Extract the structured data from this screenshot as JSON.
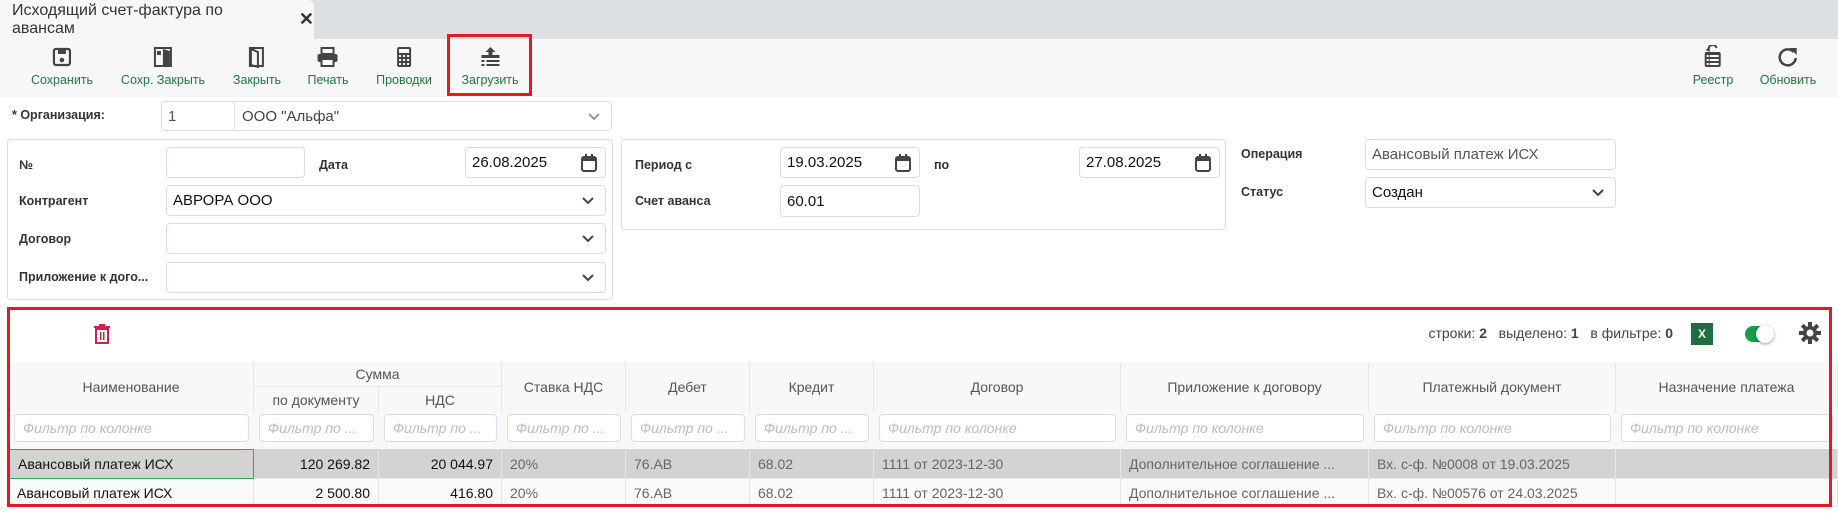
{
  "tab": {
    "title": "Исходящий счет-фактура по авансам"
  },
  "toolbar": {
    "save": "Сохранить",
    "save_close": "Сохр. Закрыть",
    "close": "Закрыть",
    "print": "Печать",
    "postings": "Проводки",
    "upload": "Загрузить",
    "registry": "Реестр",
    "refresh": "Обновить"
  },
  "form": {
    "org_label": "* Организация:",
    "org_code": "1",
    "org_name": "ООО \"Альфа\"",
    "number_label": "№",
    "number_value": "",
    "date_label": "Дата",
    "date_value": "26.08.2025",
    "counterparty_label": "Контрагент",
    "counterparty_value": "АВРОРА ООО",
    "contract_label": "Договор",
    "contract_value": "",
    "annex_label": "Приложение к дого...",
    "annex_value": "",
    "period_from_label": "Период с",
    "period_from": "19.03.2025",
    "period_to_label": "по",
    "period_to": "27.08.2025",
    "advance_account_label": "Счет аванса",
    "advance_account": "60.01",
    "operation_label": "Операция",
    "operation_value": "Авансовый платеж ИСХ",
    "status_label": "Статус",
    "status_value": "Создан"
  },
  "grid": {
    "stats": {
      "rows_label": "строки:",
      "rows": "2",
      "selected_label": "выделено:",
      "selected": "1",
      "filtered_label": "в фильтре:",
      "filtered": "0"
    },
    "excel_label": "X",
    "group_header": "Сумма",
    "columns": [
      "Наименование",
      "по документу",
      "НДС",
      "Ставка НДС",
      "Дебет",
      "Кредит",
      "Договор",
      "Приложение к договору",
      "Платежный документ",
      "Назначение платежа"
    ],
    "filter_placeholder_full": "Фильтр по колонке",
    "filter_placeholder_short": "Фильтр по ...",
    "rows": [
      [
        "Авансовый платеж ИСХ",
        "120 269.82",
        "20 044.97",
        "20%",
        "76.АВ",
        "68.02",
        "1111 от 2023-12-30",
        "Дополнительное соглашение ...",
        "Вх. с-ф. №0008 от 19.03.2025",
        ""
      ],
      [
        "Авансовый платеж ИСХ",
        "2 500.80",
        "416.80",
        "20%",
        "76.АВ",
        "68.02",
        "1111 от 2023-12-30",
        "Дополнительное соглашение ...",
        "Вх. с-ф. №00576 от 24.03.2025",
        ""
      ]
    ]
  },
  "colors": {
    "accent_green": "#1f7a3c",
    "highlight_red": "#e01b24",
    "delete_red": "#d3204a",
    "selected_row": "#d3d3d3"
  }
}
